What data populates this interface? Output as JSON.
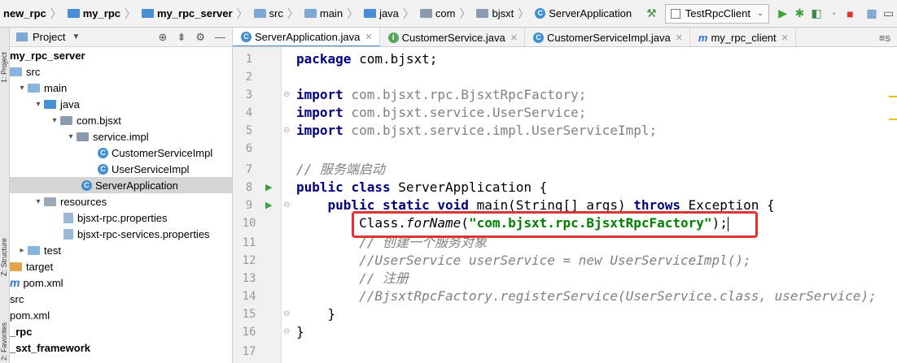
{
  "breadcrumb": [
    "new_rpc",
    "my_rpc",
    "my_rpc_server",
    "src",
    "main",
    "java",
    "com",
    "bjsxt",
    "ServerApplication"
  ],
  "run_config": "TestRpcClient",
  "side_tabs": {
    "project": "1: Project",
    "structure": "Z: Structure",
    "favorites": "2: Favorites"
  },
  "project_panel": {
    "title": "Project",
    "tree": [
      "my_rpc_server",
      "src",
      "main",
      "java",
      "com.bjsxt",
      "service.impl",
      "CustomerServiceImpl",
      "UserServiceImpl",
      "ServerApplication",
      "resources",
      "bjsxt-rpc.properties",
      "bjsxt-rpc-services.properties",
      "test",
      "target",
      "pom.xml",
      "src",
      "pom.xml",
      "_rpc",
      "_sxt_framework"
    ]
  },
  "tabs": [
    "ServerApplication.java",
    "CustomerService.java",
    "CustomerServiceImpl.java",
    "my_rpc_client"
  ],
  "tab_more": "≡s",
  "line_numbers": [
    "1",
    "2",
    "3",
    "4",
    "5",
    "6",
    "7",
    "8",
    "9",
    "10",
    "11",
    "12",
    "13",
    "14",
    "15",
    "16",
    "17"
  ],
  "code": {
    "l1_kw": "package",
    "l1_rest": " com.bjsxt;",
    "l3_kw": "import",
    "l3_rest": " com.bjsxt.rpc.BjsxtRpcFactory;",
    "l4_kw": "import",
    "l4_rest": " com.bjsxt.service.UserService;",
    "l5_kw": "import",
    "l5_rest": " com.bjsxt.service.impl.UserServiceImpl;",
    "l7": "// 服务端启动",
    "l8_kw1": "public",
    "l8_kw2": "class",
    "l8_rest": " ServerApplication {",
    "l9_kw1": "public",
    "l9_kw2": "static",
    "l9_kw3": "void",
    "l9_mid": " main(String[] args) ",
    "l9_kw4": "throws",
    "l9_rest": " Exception {",
    "l10_a": "Class.",
    "l10_b": "forName",
    "l10_c": "(",
    "l10_str": "\"com.bjsxt.rpc.BjsxtRpcFactory\"",
    "l10_d": ");",
    "l11": "// 创建一个服务对象",
    "l12": "//UserService userService = new UserServiceImpl();",
    "l13": "// 注册",
    "l14": "//BjsxtRpcFactory.registerService(UserService.class, userService);",
    "l15": "}",
    "l16": "}"
  }
}
